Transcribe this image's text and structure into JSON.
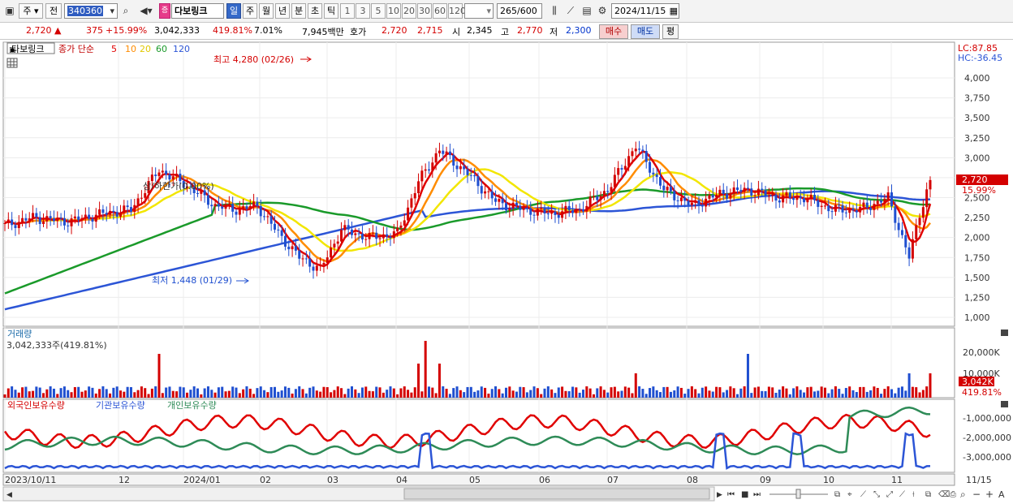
{
  "toolbar": {
    "market": "주",
    "prev": "전",
    "code": "340360",
    "name": "다보링크",
    "name_prefix": "증",
    "periods": [
      "일",
      "주",
      "월",
      "년",
      "분",
      "초",
      "틱"
    ],
    "selected_period": "일",
    "intervals": [
      "1",
      "3",
      "5",
      "10",
      "20",
      "30",
      "60",
      "120"
    ],
    "count": "265",
    "count_total": "/600",
    "date": "2024/11/15"
  },
  "quote": {
    "price": "2,720",
    "arrow": "▲",
    "change": "375",
    "change_pct": "+15.99%",
    "volume": "3,042,333",
    "volume_pct": "419.81%",
    "turnover": "7.01%",
    "amount": "7,945백만",
    "ask_label": "호가",
    "ask": "2,720",
    "bid": "2,715",
    "open_label": "시",
    "open": "2,345",
    "high_label": "고",
    "high": "2,770",
    "low_label": "저",
    "low": "2,300",
    "buy_label": "매수",
    "sell_label": "매도",
    "eval_label": "평"
  },
  "price_panel": {
    "title": "다보링크",
    "ma_label": "종가 단순",
    "ma_periods": [
      "5",
      "10",
      "20",
      "60",
      "120"
    ],
    "lc": "LC:87.85",
    "hc": "HC:-36.45",
    "y_ticks": [
      "4,000",
      "3,750",
      "3,500",
      "3,250",
      "3,000",
      "2,750",
      "2,500",
      "2,250",
      "2,000",
      "1,750",
      "1,500",
      "1,250",
      "1,000"
    ],
    "max_note": "최고 4,280 (02/26)",
    "min_note": "최저 1,448 (01/29)",
    "limit_note": "상/하한가(0.00%)",
    "last_price": "2,720",
    "last_pct": "15.99%"
  },
  "volume_panel": {
    "title": "거래량",
    "value": "3,042,333주(419.81%)",
    "ticks": [
      "20,000K",
      "10,000K"
    ],
    "last": "3,042K",
    "last_pct": "419.81%"
  },
  "holding_panel": {
    "series": [
      "외국인보유수량",
      "기관보유수량",
      "개인보유수량"
    ],
    "ticks": [
      "-1,000,000",
      "-2,000,000",
      "-3,000,000"
    ]
  },
  "x_axis": {
    "labels": [
      "2023/10/11",
      "12",
      "2024/01",
      "02",
      "03",
      "04",
      "05",
      "06",
      "07",
      "08",
      "09",
      "10",
      "11"
    ],
    "end": "11/15"
  },
  "colors": {
    "ma5": "#e00000",
    "ma10": "#ff8c00",
    "ma20": "#f2e600",
    "ma60": "#1a9a2a",
    "ma120": "#2c55d6",
    "up": "#d40000",
    "down": "#1f4fd0",
    "foreign": "#e00000",
    "inst": "#2c55d6",
    "indiv": "#2e8b57"
  }
}
